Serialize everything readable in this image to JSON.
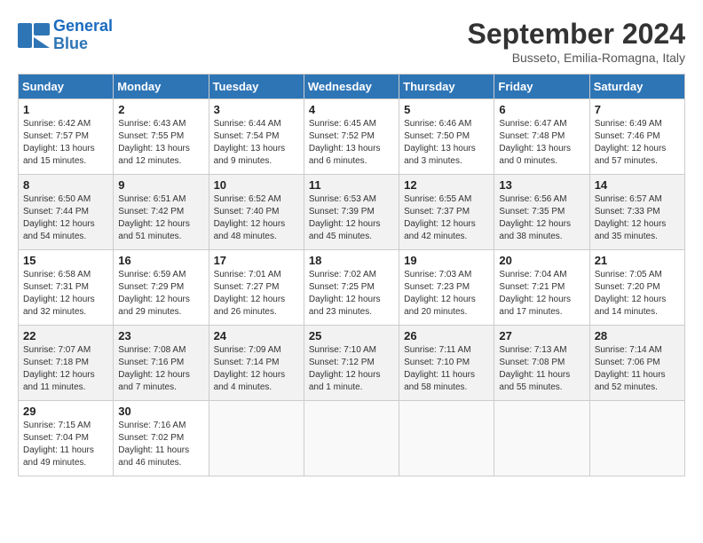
{
  "logo": {
    "line1": "General",
    "line2": "Blue"
  },
  "title": "September 2024",
  "subtitle": "Busseto, Emilia-Romagna, Italy",
  "days_of_week": [
    "Sunday",
    "Monday",
    "Tuesday",
    "Wednesday",
    "Thursday",
    "Friday",
    "Saturday"
  ],
  "weeks": [
    [
      {
        "day": 1,
        "info": "Sunrise: 6:42 AM\nSunset: 7:57 PM\nDaylight: 13 hours\nand 15 minutes."
      },
      {
        "day": 2,
        "info": "Sunrise: 6:43 AM\nSunset: 7:55 PM\nDaylight: 13 hours\nand 12 minutes."
      },
      {
        "day": 3,
        "info": "Sunrise: 6:44 AM\nSunset: 7:54 PM\nDaylight: 13 hours\nand 9 minutes."
      },
      {
        "day": 4,
        "info": "Sunrise: 6:45 AM\nSunset: 7:52 PM\nDaylight: 13 hours\nand 6 minutes."
      },
      {
        "day": 5,
        "info": "Sunrise: 6:46 AM\nSunset: 7:50 PM\nDaylight: 13 hours\nand 3 minutes."
      },
      {
        "day": 6,
        "info": "Sunrise: 6:47 AM\nSunset: 7:48 PM\nDaylight: 13 hours\nand 0 minutes."
      },
      {
        "day": 7,
        "info": "Sunrise: 6:49 AM\nSunset: 7:46 PM\nDaylight: 12 hours\nand 57 minutes."
      }
    ],
    [
      {
        "day": 8,
        "info": "Sunrise: 6:50 AM\nSunset: 7:44 PM\nDaylight: 12 hours\nand 54 minutes."
      },
      {
        "day": 9,
        "info": "Sunrise: 6:51 AM\nSunset: 7:42 PM\nDaylight: 12 hours\nand 51 minutes."
      },
      {
        "day": 10,
        "info": "Sunrise: 6:52 AM\nSunset: 7:40 PM\nDaylight: 12 hours\nand 48 minutes."
      },
      {
        "day": 11,
        "info": "Sunrise: 6:53 AM\nSunset: 7:39 PM\nDaylight: 12 hours\nand 45 minutes."
      },
      {
        "day": 12,
        "info": "Sunrise: 6:55 AM\nSunset: 7:37 PM\nDaylight: 12 hours\nand 42 minutes."
      },
      {
        "day": 13,
        "info": "Sunrise: 6:56 AM\nSunset: 7:35 PM\nDaylight: 12 hours\nand 38 minutes."
      },
      {
        "day": 14,
        "info": "Sunrise: 6:57 AM\nSunset: 7:33 PM\nDaylight: 12 hours\nand 35 minutes."
      }
    ],
    [
      {
        "day": 15,
        "info": "Sunrise: 6:58 AM\nSunset: 7:31 PM\nDaylight: 12 hours\nand 32 minutes."
      },
      {
        "day": 16,
        "info": "Sunrise: 6:59 AM\nSunset: 7:29 PM\nDaylight: 12 hours\nand 29 minutes."
      },
      {
        "day": 17,
        "info": "Sunrise: 7:01 AM\nSunset: 7:27 PM\nDaylight: 12 hours\nand 26 minutes."
      },
      {
        "day": 18,
        "info": "Sunrise: 7:02 AM\nSunset: 7:25 PM\nDaylight: 12 hours\nand 23 minutes."
      },
      {
        "day": 19,
        "info": "Sunrise: 7:03 AM\nSunset: 7:23 PM\nDaylight: 12 hours\nand 20 minutes."
      },
      {
        "day": 20,
        "info": "Sunrise: 7:04 AM\nSunset: 7:21 PM\nDaylight: 12 hours\nand 17 minutes."
      },
      {
        "day": 21,
        "info": "Sunrise: 7:05 AM\nSunset: 7:20 PM\nDaylight: 12 hours\nand 14 minutes."
      }
    ],
    [
      {
        "day": 22,
        "info": "Sunrise: 7:07 AM\nSunset: 7:18 PM\nDaylight: 12 hours\nand 11 minutes."
      },
      {
        "day": 23,
        "info": "Sunrise: 7:08 AM\nSunset: 7:16 PM\nDaylight: 12 hours\nand 7 minutes."
      },
      {
        "day": 24,
        "info": "Sunrise: 7:09 AM\nSunset: 7:14 PM\nDaylight: 12 hours\nand 4 minutes."
      },
      {
        "day": 25,
        "info": "Sunrise: 7:10 AM\nSunset: 7:12 PM\nDaylight: 12 hours\nand 1 minute."
      },
      {
        "day": 26,
        "info": "Sunrise: 7:11 AM\nSunset: 7:10 PM\nDaylight: 11 hours\nand 58 minutes."
      },
      {
        "day": 27,
        "info": "Sunrise: 7:13 AM\nSunset: 7:08 PM\nDaylight: 11 hours\nand 55 minutes."
      },
      {
        "day": 28,
        "info": "Sunrise: 7:14 AM\nSunset: 7:06 PM\nDaylight: 11 hours\nand 52 minutes."
      }
    ],
    [
      {
        "day": 29,
        "info": "Sunrise: 7:15 AM\nSunset: 7:04 PM\nDaylight: 11 hours\nand 49 minutes."
      },
      {
        "day": 30,
        "info": "Sunrise: 7:16 AM\nSunset: 7:02 PM\nDaylight: 11 hours\nand 46 minutes."
      },
      null,
      null,
      null,
      null,
      null
    ]
  ]
}
